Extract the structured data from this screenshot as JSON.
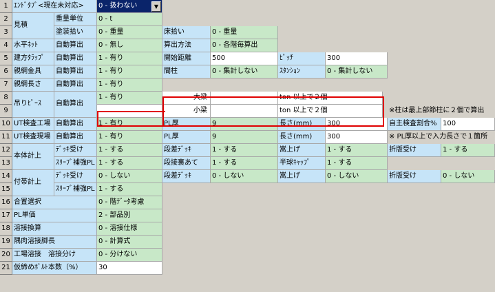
{
  "rows": {
    "r1": {
      "num": "1",
      "label": "ｴﾝﾄﾞﾀﾌﾞ<現在未対応>",
      "value": "0 - 扱わない"
    },
    "r2": {
      "num": "2",
      "group": "見積",
      "sub": "重量単位",
      "value": "0 - t"
    },
    "r3": {
      "num": "3",
      "sub": "塗装拾い",
      "value": "0 - 重量",
      "label2": "床拾い",
      "value2": "0 - 重量"
    },
    "r4": {
      "num": "4",
      "label": "水平ﾈｯﾄ",
      "sub": "自動算出",
      "value": "0 - 無し",
      "label2": "算出方法",
      "value2": "0 - 各階毎算出"
    },
    "r5": {
      "num": "5",
      "label": "建方ﾀﾗｯﾌﾟ",
      "sub": "自動算出",
      "value": "1 - 有り",
      "label2": "開始距離",
      "value2": "500",
      "label3": "ﾋﾟｯﾁ",
      "value3": "300"
    },
    "r6": {
      "num": "6",
      "label": "親綱金具",
      "sub": "自動算出",
      "value": "1 - 有り",
      "label2": "間柱",
      "value2": "0 - 集計しない",
      "label3": "ｽﾀﾝｼｮﾝ",
      "value3": "0 - 集計しない"
    },
    "r7": {
      "num": "7",
      "label": "親綱長さ",
      "sub": "自動算出",
      "value": "1 - 有り"
    },
    "r8": {
      "num": "8",
      "label2": "大梁",
      "value3": "ton 以上で２個"
    },
    "r9": {
      "num": "9",
      "label2": "小梁",
      "value3": "ton 以上で２個",
      "note": "※柱は最上部節柱に２個で算出"
    },
    "r89": {
      "label": "吊りﾋﾟｰｽ",
      "sub": "自動算出",
      "value": "1 - 有り"
    },
    "r10": {
      "num": "10",
      "label": "UT検査工場",
      "sub": "自動算出",
      "value": "1 - 有り",
      "label2": "PL厚",
      "value2": "9",
      "label3": "長さ(mm)",
      "value3": "300",
      "label4": "自主検査割合%",
      "value4": "100"
    },
    "r11": {
      "num": "11",
      "label": "UT検査現場",
      "sub": "自動算出",
      "value": "1 - 有り",
      "label2": "PL厚",
      "value2": "9",
      "label3": "長さ(mm)",
      "value3": "300",
      "note": "※ PL厚以上で入力長さで１箇所"
    },
    "r12": {
      "num": "12",
      "group": "本体計上",
      "sub": "ﾃﾞｯｷ受け",
      "value": "1 - する",
      "label2": "段差ﾃﾞｯｷ",
      "value2": "1 - する",
      "label3": "嵩上げ",
      "value3": "1 - する",
      "label4": "折版受け",
      "value4": "1 - する"
    },
    "r13": {
      "num": "13",
      "sub": "ｽﾘｰﾌﾞ補強PL",
      "value": "1 - する",
      "label2": "段接裏あて",
      "value2": "1 - する",
      "label3": "半球ｷｬｯﾌﾟ",
      "value3": "1 - する"
    },
    "r14": {
      "num": "14",
      "group": "付帯計上",
      "sub": "ﾃﾞｯｷ受け",
      "value": "0 - しない",
      "label2": "段差ﾃﾞｯｷ",
      "value2": "0 - しない",
      "label3": "嵩上げ",
      "value3": "0 - しない",
      "label4": "折版受け",
      "value4": "0 - しない"
    },
    "r15": {
      "num": "15",
      "sub": "ｽﾘｰﾌﾞ補強PL",
      "value": "1 - する"
    },
    "r16": {
      "num": "16",
      "label": "合置選択",
      "value": "0 - 階ﾃﾞｰﾀ考慮"
    },
    "r17": {
      "num": "17",
      "label": "PL単価",
      "value": "2 - 部品別"
    },
    "r18": {
      "num": "18",
      "label": "溶接換算",
      "value": "0 - 溶接仕様"
    },
    "r19": {
      "num": "19",
      "label": "隅肉溶接脚長",
      "value": "0 - 計算式"
    },
    "r20": {
      "num": "20",
      "label": "工場溶接　溶接分け",
      "value": "0 - 分けない"
    },
    "r21": {
      "num": "21",
      "label": "仮締めﾎﾞﾙﾄ本数（%）",
      "value": "30"
    }
  },
  "dropdown_icon": "chevron-down-icon",
  "colors": {
    "label_bg": "#c6e4f8",
    "value_bg": "#c8e8c8",
    "highlight": "#e00000",
    "selected": "#0a246a"
  }
}
